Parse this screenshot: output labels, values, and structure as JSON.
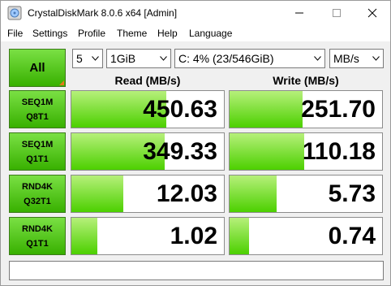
{
  "window": {
    "title": "CrystalDiskMark 8.0.6 x64 [Admin]"
  },
  "menu": [
    "File",
    "Settings",
    "Profile",
    "Theme",
    "Help",
    "Language"
  ],
  "controls": {
    "all_label": "All",
    "count": "5",
    "size": "1GiB",
    "drive": "C: 4% (23/546GiB)",
    "unit": "MB/s"
  },
  "headers": {
    "read": "Read (MB/s)",
    "write": "Write (MB/s)"
  },
  "rows": [
    {
      "line1": "SEQ1M",
      "line2": "Q8T1",
      "read": "450.63",
      "write": "251.70",
      "read_fill": 0.62,
      "write_fill": 0.48
    },
    {
      "line1": "SEQ1M",
      "line2": "Q1T1",
      "read": "349.33",
      "write": "110.18",
      "read_fill": 0.61,
      "write_fill": 0.49
    },
    {
      "line1": "RND4K",
      "line2": "Q32T1",
      "read": "12.03",
      "write": "5.73",
      "read_fill": 0.34,
      "write_fill": 0.31
    },
    {
      "line1": "RND4K",
      "line2": "Q1T1",
      "read": "1.02",
      "write": "0.74",
      "read_fill": 0.17,
      "write_fill": 0.13
    }
  ],
  "comment": "",
  "colors": {
    "bar": "#4cd000",
    "label_green": "#38b000",
    "corner": "#e8771a"
  }
}
